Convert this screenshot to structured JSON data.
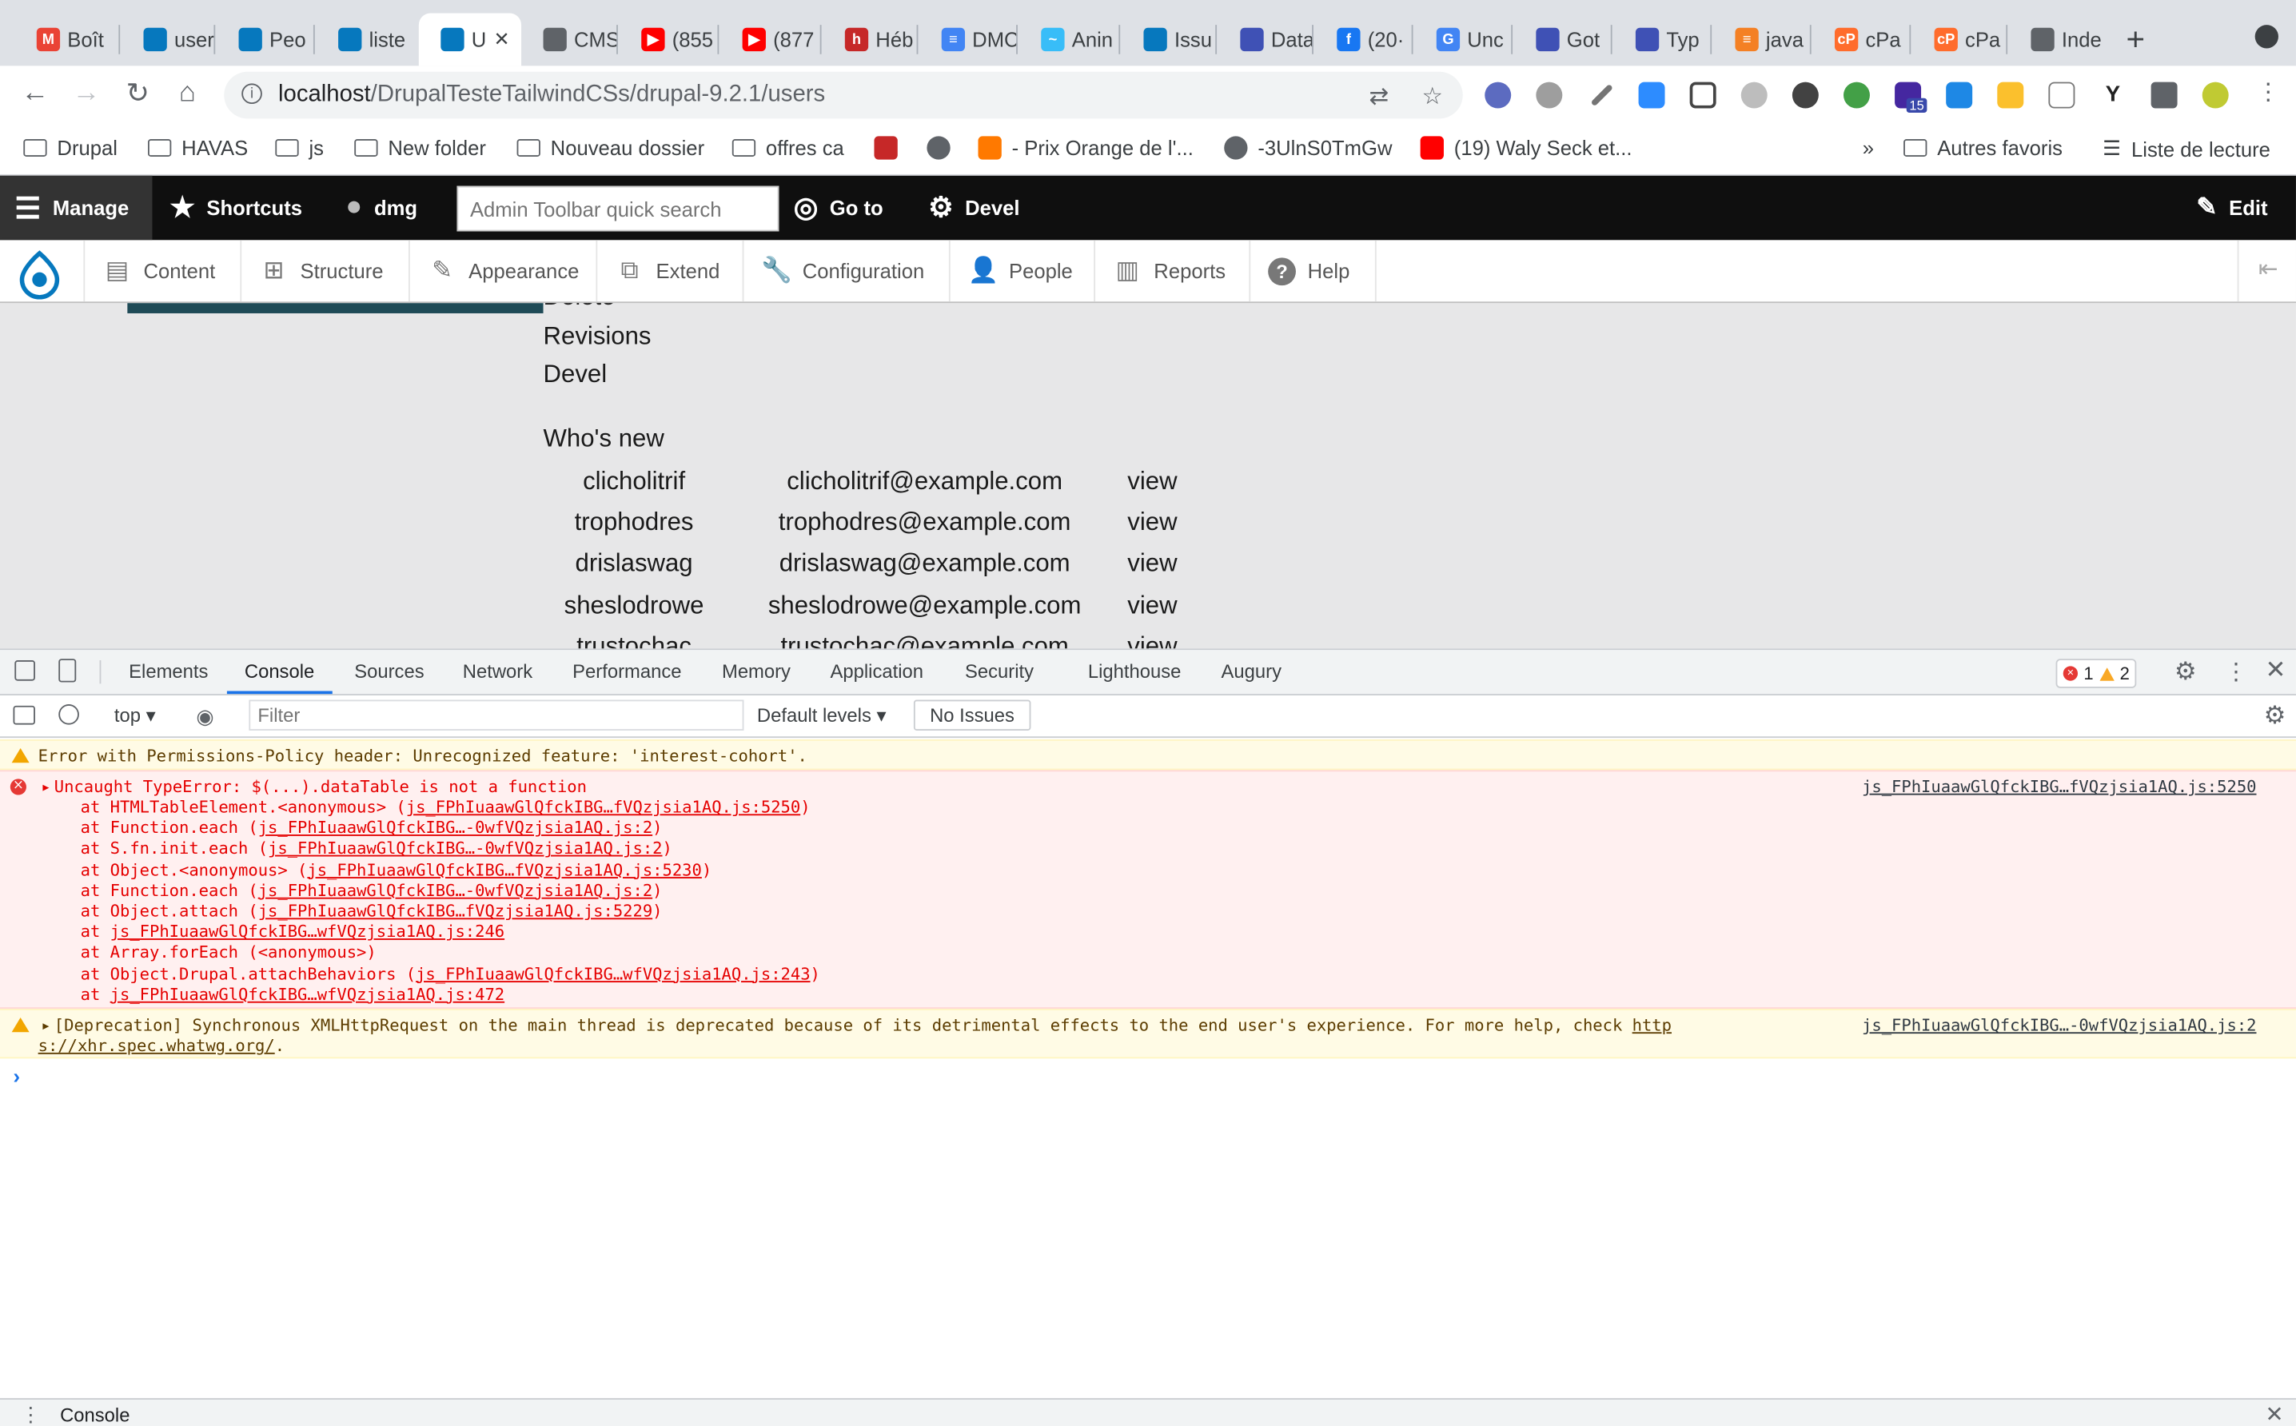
{
  "browser": {
    "tabs": [
      {
        "title": "Boît",
        "icon": "gmail-icon",
        "color": "#ea4335",
        "glyph": "M"
      },
      {
        "title": "user",
        "icon": "drupal-icon",
        "color": "#0678be",
        "glyph": ""
      },
      {
        "title": "Peo",
        "icon": "drupal-icon",
        "color": "#0678be",
        "glyph": ""
      },
      {
        "title": "liste",
        "icon": "drupal-icon",
        "color": "#0678be",
        "glyph": ""
      },
      {
        "title": "U",
        "icon": "drupal-icon",
        "color": "#0678be",
        "glyph": "",
        "active": true
      },
      {
        "title": "CMS",
        "icon": "globe-icon",
        "color": "#5f6368",
        "glyph": ""
      },
      {
        "title": "(855",
        "icon": "youtube-icon",
        "color": "#ff0000",
        "glyph": "▶"
      },
      {
        "title": "(877",
        "icon": "youtube-icon",
        "color": "#ff0000",
        "glyph": "▶"
      },
      {
        "title": "Héb",
        "icon": "hosting-icon",
        "color": "#c62828",
        "glyph": "h"
      },
      {
        "title": "DMC",
        "icon": "docs-icon",
        "color": "#4285f4",
        "glyph": "≡"
      },
      {
        "title": "Anin",
        "icon": "tailwind-icon",
        "color": "#38bdf8",
        "glyph": "~"
      },
      {
        "title": "Issu",
        "icon": "drupal-icon",
        "color": "#0678be",
        "glyph": ""
      },
      {
        "title": "Data",
        "icon": "circle-icon",
        "color": "#3f51b5",
        "glyph": ""
      },
      {
        "title": "(20·",
        "icon": "facebook-icon",
        "color": "#1877f2",
        "glyph": "f"
      },
      {
        "title": "Unc",
        "icon": "google-icon",
        "color": "#4285f4",
        "glyph": "G"
      },
      {
        "title": "Got",
        "icon": "circle-icon",
        "color": "#3f51b5",
        "glyph": ""
      },
      {
        "title": "Typ",
        "icon": "circle-icon",
        "color": "#3f51b5",
        "glyph": ""
      },
      {
        "title": "java",
        "icon": "stackoverflow-icon",
        "color": "#f48024",
        "glyph": "≡"
      },
      {
        "title": "cPa",
        "icon": "cpanel-icon",
        "color": "#ff6c2c",
        "glyph": "cP"
      },
      {
        "title": "cPa",
        "icon": "cpanel-icon",
        "color": "#ff6c2c",
        "glyph": "cP"
      },
      {
        "title": "Inde",
        "icon": "globe-icon",
        "color": "#5f6368",
        "glyph": ""
      }
    ],
    "url_host": "localhost",
    "url_path": "/DrupalTesteTailwindCSs/drupal-9.2.1/users",
    "extension_badge": "15",
    "bookmarks": [
      {
        "label": "Drupal",
        "type": "folder"
      },
      {
        "label": "HAVAS",
        "type": "folder"
      },
      {
        "label": "js",
        "type": "folder"
      },
      {
        "label": "New folder",
        "type": "folder"
      },
      {
        "label": "Nouveau dossier",
        "type": "folder"
      },
      {
        "label": "offres ca",
        "type": "folder"
      },
      {
        "label": "",
        "type": "icon"
      },
      {
        "label": "",
        "type": "icon"
      },
      {
        "label": "- Prix Orange de l'...",
        "type": "link"
      },
      {
        "label": "-3UlnS0TmGw",
        "type": "link"
      },
      {
        "label": "(19) Waly Seck et...",
        "type": "link"
      }
    ],
    "bookmarks_more": "»",
    "other_bookmarks": "Autres favoris",
    "reading_list": "Liste de lecture"
  },
  "admin_toolbar": {
    "manage": "Manage",
    "shortcuts": "Shortcuts",
    "user": "dmg",
    "search_placeholder": "Admin Toolbar quick search",
    "goto": "Go to",
    "devel": "Devel",
    "edit": "Edit",
    "tray": [
      "Content",
      "Structure",
      "Appearance",
      "Extend",
      "Configuration",
      "People",
      "Reports",
      "Help"
    ]
  },
  "page": {
    "cut_link": "Delete",
    "links": [
      "Revisions",
      "Devel"
    ],
    "whos_new_title": "Who's new",
    "users": [
      {
        "name": "clicholitrif",
        "email": "clicholitrif@example.com",
        "action": "view"
      },
      {
        "name": "trophodres",
        "email": "trophodres@example.com",
        "action": "view"
      },
      {
        "name": "drislaswag",
        "email": "drislaswag@example.com",
        "action": "view"
      },
      {
        "name": "sheslodrowe",
        "email": "sheslodrowe@example.com",
        "action": "view"
      },
      {
        "name": "trustochac",
        "email": "trustochac@example.com",
        "action": "view"
      }
    ]
  },
  "devtools": {
    "tabs": [
      "Elements",
      "Console",
      "Sources",
      "Network",
      "Performance",
      "Memory",
      "Application",
      "Security",
      "Lighthouse",
      "Augury"
    ],
    "active_tab": "Console",
    "error_count": "1",
    "warning_count": "2",
    "context": "top",
    "filter_placeholder": "Filter",
    "levels": "Default levels",
    "issues": "No Issues",
    "messages": {
      "permissions_warning": "Error with Permissions-Policy header: Unrecognized feature: 'interest-cohort'.",
      "error_head": "Uncaught TypeError: $(...).dataTable is not a function",
      "error_source": "js_FPhIuaawGlQfckIBG…fVQzjsia1AQ.js:5250",
      "stack": [
        {
          "pre": "    at HTMLTableElement.<anonymous> (",
          "link": "js_FPhIuaawGlQfckIBG…fVQzjsia1AQ.js:5250",
          "post": ")"
        },
        {
          "pre": "    at Function.each (",
          "link": "js_FPhIuaawGlQfckIBG…-0wfVQzjsia1AQ.js:2",
          "post": ")"
        },
        {
          "pre": "    at S.fn.init.each (",
          "link": "js_FPhIuaawGlQfckIBG…-0wfVQzjsia1AQ.js:2",
          "post": ")"
        },
        {
          "pre": "    at Object.<anonymous> (",
          "link": "js_FPhIuaawGlQfckIBG…fVQzjsia1AQ.js:5230",
          "post": ")"
        },
        {
          "pre": "    at Function.each (",
          "link": "js_FPhIuaawGlQfckIBG…-0wfVQzjsia1AQ.js:2",
          "post": ")"
        },
        {
          "pre": "    at Object.attach (",
          "link": "js_FPhIuaawGlQfckIBG…fVQzjsia1AQ.js:5229",
          "post": ")"
        },
        {
          "pre": "    at ",
          "link": "js_FPhIuaawGlQfckIBG…wfVQzjsia1AQ.js:246",
          "post": ""
        },
        {
          "pre": "    at Array.forEach (<anonymous>)",
          "link": "",
          "post": ""
        },
        {
          "pre": "    at Object.Drupal.attachBehaviors (",
          "link": "js_FPhIuaawGlQfckIBG…wfVQzjsia1AQ.js:243",
          "post": ")"
        },
        {
          "pre": "    at ",
          "link": "js_FPhIuaawGlQfckIBG…wfVQzjsia1AQ.js:472",
          "post": ""
        }
      ],
      "deprecation_line1": "[Deprecation] Synchronous XMLHttpRequest on the main thread is deprecated because of its detrimental effects to the end user's experience. For more help, check ",
      "deprecation_link1": "http",
      "deprecation_link2": "s://xhr.spec.whatwg.org/",
      "deprecation_tail": ".",
      "deprecation_source": "js_FPhIuaawGlQfckIBG…-0wfVQzjsia1AQ.js:2"
    },
    "drawer_title": "Console"
  },
  "colors": {
    "toolbar_bg": "#0f0f0f",
    "drupal_blue": "#0678be",
    "page_bg": "#e7e7e8",
    "error_red": "#e50000",
    "accent_blue": "#1a73e8"
  }
}
